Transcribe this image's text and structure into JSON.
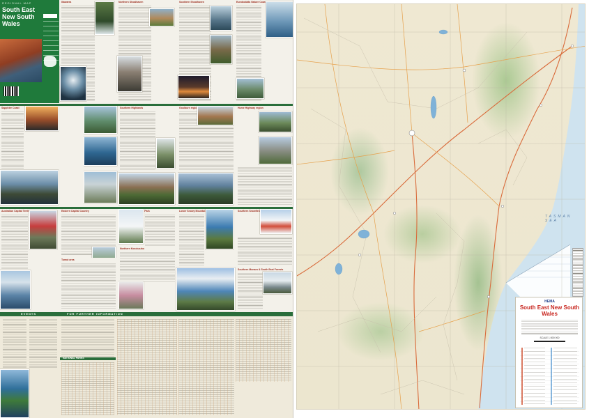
{
  "guide": {
    "cover": {
      "kicker": "REGIONAL MAP",
      "title": "South East New South Wales"
    },
    "events_strip": {
      "left": "EVENTS",
      "right": "FOR FURTHER INFORMATION"
    },
    "national_parks": "NATIONAL PARKS",
    "sections": [
      {
        "id": "illawarra",
        "head": "Illawarra"
      },
      {
        "id": "northern-shoalhaven",
        "head": "Northern Shoalhaven"
      },
      {
        "id": "southern-shoalhaven",
        "head": "Southern Shoalhaven"
      },
      {
        "id": "eurobodalla",
        "head": "Eurobodalla Nature Coast"
      },
      {
        "id": "sapphire-coast",
        "head": "Sapphire Coast"
      },
      {
        "id": "southern-highlands",
        "head": "Southern Highlands"
      },
      {
        "id": "goulburn-region",
        "head": "Goulburn region"
      },
      {
        "id": "hume-highway",
        "head": "Hume Highway region"
      },
      {
        "id": "act-tourism",
        "head": "Australian Capital Territory"
      },
      {
        "id": "eastern-capital-country",
        "head": "Eastern Capital Country"
      },
      {
        "id": "kosciuszko",
        "head": "Kosciuszko National Park"
      },
      {
        "id": "lower-snowy",
        "head": "Lower Snowy Mountains Highway"
      },
      {
        "id": "southern-snowfields",
        "head": "Southern Snowfields"
      },
      {
        "id": "northern-kosciuszko",
        "head": "Northern Kosciuszko"
      },
      {
        "id": "tumut-area",
        "head": "Tumut area"
      },
      {
        "id": "southern-monaro",
        "head": "Southern Monaro & South East Forests"
      }
    ]
  },
  "map": {
    "sea_label": "TASMAN SEA",
    "legend": {
      "brand": "HEMA",
      "title": "South East New South Wales",
      "scale": "SCALE 1:500 000"
    }
  }
}
